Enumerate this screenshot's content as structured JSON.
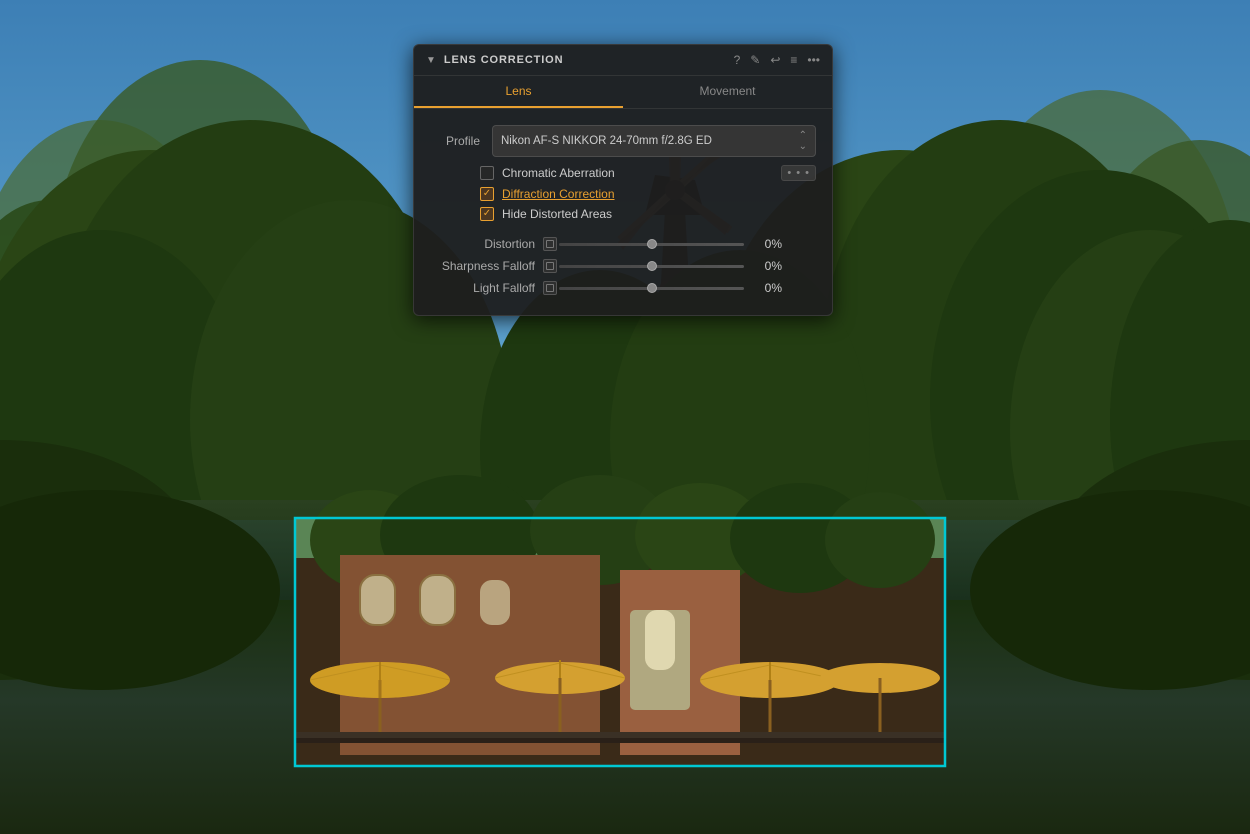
{
  "background": {
    "sky_color_top": "#3d7fb5",
    "sky_color_bottom": "#8abfd8",
    "ground_color": "#253020"
  },
  "panel": {
    "title": "LENS CORRECTION",
    "header_icons": [
      "?",
      "✎",
      "↩",
      "≡",
      "•••"
    ],
    "tabs": [
      {
        "label": "Lens",
        "active": true
      },
      {
        "label": "Movement",
        "active": false
      }
    ],
    "profile_label": "Profile",
    "profile_value": "Nikon AF-S NIKKOR 24-70mm f/2.8G ED",
    "checkboxes": [
      {
        "label": "Chromatic Aberration",
        "checked": false,
        "has_dots": true,
        "underlined": false
      },
      {
        "label": "Diffraction Correction",
        "checked": true,
        "has_dots": false,
        "underlined": true
      },
      {
        "label": "Hide Distorted Areas",
        "checked": true,
        "has_dots": false,
        "underlined": false
      }
    ],
    "sliders": [
      {
        "label": "Distortion",
        "value": "0%",
        "position": 50
      },
      {
        "label": "Sharpness Falloff",
        "value": "0%",
        "position": 50
      },
      {
        "label": "Light Falloff",
        "value": "0%",
        "position": 50
      }
    ]
  },
  "zoom_box": {
    "border_color": "#00c8d4"
  }
}
